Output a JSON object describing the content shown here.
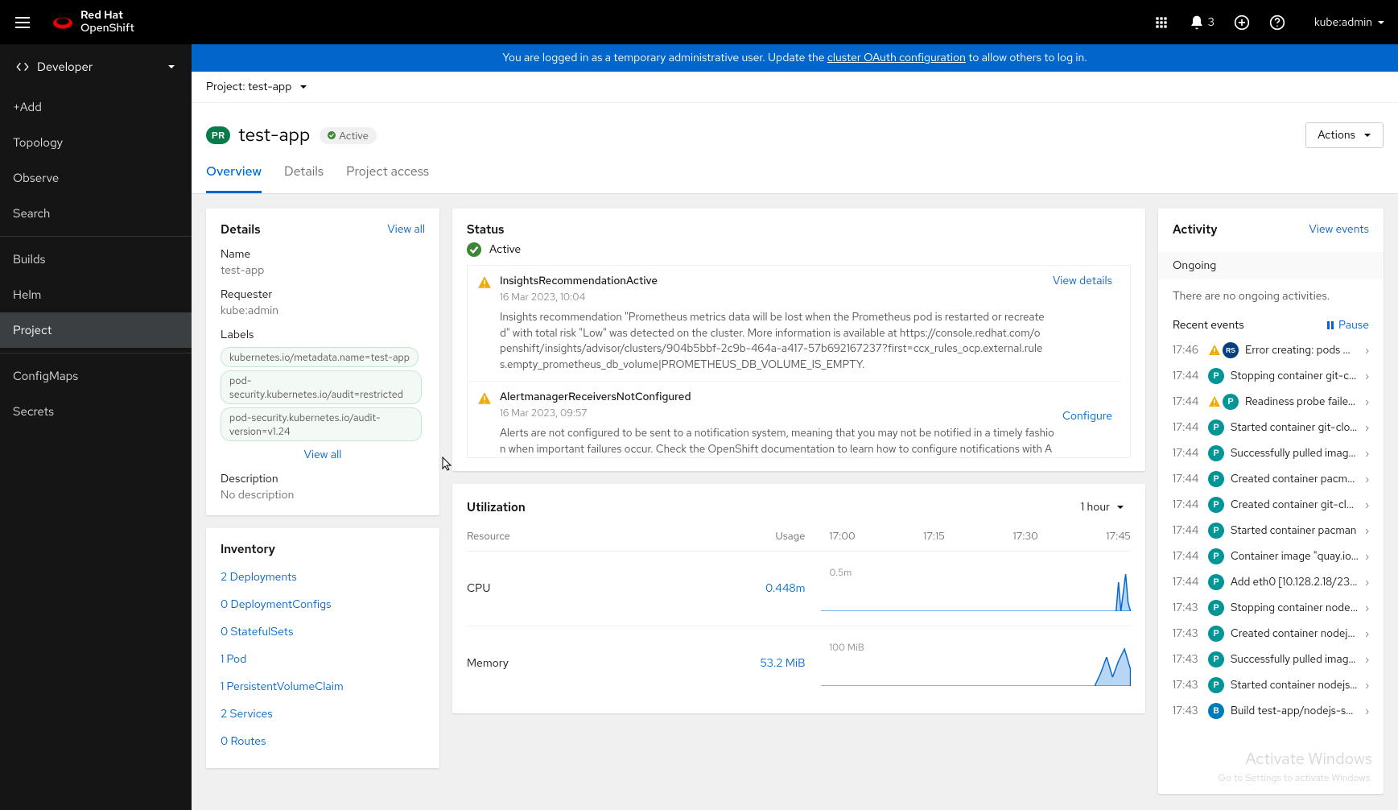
{
  "brand": {
    "rh": "Red Hat",
    "os": "OpenShift"
  },
  "header": {
    "notif_count": "3",
    "username": "kube:admin"
  },
  "sidebar": {
    "perspective": "Developer",
    "items": [
      "+Add",
      "Topology",
      "Observe",
      "Search",
      "Builds",
      "Helm",
      "Project",
      "ConfigMaps",
      "Secrets"
    ]
  },
  "banner": {
    "prefix": "You are logged in as a temporary administrative user. Update the ",
    "link": "cluster OAuth configuration",
    "suffix": " to allow others to log in."
  },
  "project_row": {
    "label": "Project: test-app"
  },
  "title": {
    "badge": "PR",
    "name": "test-app",
    "status": "Active",
    "actions": "Actions"
  },
  "tabs": [
    "Overview",
    "Details",
    "Project access"
  ],
  "details": {
    "heading": "Details",
    "viewall": "View all",
    "name_k": "Name",
    "name_v": "test-app",
    "req_k": "Requester",
    "req_v": "kube:admin",
    "labels_k": "Labels",
    "labels": [
      "kubernetes.io/metadata.name=test-app",
      "pod-security.kubernetes.io/audit=restricted",
      "pod-security.kubernetes.io/audit-version=v1.24"
    ],
    "view_all_labels": "View all",
    "desc_k": "Description",
    "desc_v": "No description"
  },
  "inventory": {
    "heading": "Inventory",
    "items": [
      "2 Deployments",
      "0 DeploymentConfigs",
      "0 StatefulSets",
      "1 Pod",
      "1 PersistentVolumeClaim",
      "2 Services",
      "0 Routes"
    ]
  },
  "status": {
    "heading": "Status",
    "active": "Active",
    "alerts": [
      {
        "title": "InsightsRecommendationActive",
        "time": "16 Mar 2023, 10:04",
        "desc": "Insights recommendation \"Prometheus metrics data will be lost when the Prometheus pod is restarted or recreated\" with total risk \"Low\" was detected on the cluster. More information is available at https://console.redhat.com/openshift/insights/advisor/clusters/904b5bbf-2c9b-464a-a417-57b692167237?first=ccx_rules_ocp.external.rules.empty_prometheus_db_volume|PROMETHEUS_DB_VOLUME_IS_EMPTY.",
        "action": "View details"
      },
      {
        "title": "AlertmanagerReceiversNotConfigured",
        "time": "16 Mar 2023, 09:57",
        "desc": "Alerts are not configured to be sent to a notification system, meaning that you may not be notified in a timely fashion when important failures occur. Check the OpenShift documentation to learn how to configure notifications with Alertmanager.",
        "action": "Configure"
      }
    ]
  },
  "utilization": {
    "heading": "Utilization",
    "range": "1 hour",
    "col_resource": "Resource",
    "col_usage": "Usage",
    "times": [
      "17:00",
      "17:15",
      "17:30",
      "17:45"
    ],
    "rows": [
      {
        "name": "CPU",
        "usage": "0.448m",
        "scale": "0.5m"
      },
      {
        "name": "Memory",
        "usage": "53.2 MiB",
        "scale": "100 MiB"
      }
    ]
  },
  "activity": {
    "heading": "Activity",
    "view_events": "View events",
    "ongoing_h": "Ongoing",
    "no_ongoing": "There are no ongoing activities.",
    "recent_h": "Recent events",
    "pause": "Pause",
    "events": [
      {
        "time": "17:46",
        "warn": true,
        "badge": "RS",
        "badge_cls": "badge-rs",
        "text": "Error creating: pods …"
      },
      {
        "time": "17:44",
        "warn": false,
        "badge": "P",
        "badge_cls": "badge-p",
        "text": "Stopping container git-cl…"
      },
      {
        "time": "17:44",
        "warn": true,
        "badge": "P",
        "badge_cls": "badge-p",
        "text": "Readiness probe faile…"
      },
      {
        "time": "17:44",
        "warn": false,
        "badge": "P",
        "badge_cls": "badge-p",
        "text": "Started container git-clo…"
      },
      {
        "time": "17:44",
        "warn": false,
        "badge": "P",
        "badge_cls": "badge-p",
        "text": "Successfully pulled imag…"
      },
      {
        "time": "17:44",
        "warn": false,
        "badge": "P",
        "badge_cls": "badge-p",
        "text": "Created container pacman"
      },
      {
        "time": "17:44",
        "warn": false,
        "badge": "P",
        "badge_cls": "badge-p",
        "text": "Created container git-clo…"
      },
      {
        "time": "17:44",
        "warn": false,
        "badge": "P",
        "badge_cls": "badge-p",
        "text": "Started container pacman"
      },
      {
        "time": "17:44",
        "warn": false,
        "badge": "P",
        "badge_cls": "badge-p",
        "text": "Container image \"quay.io…"
      },
      {
        "time": "17:44",
        "warn": false,
        "badge": "P",
        "badge_cls": "badge-p",
        "text": "Add eth0 [10.128.2.18/23]…"
      },
      {
        "time": "17:43",
        "warn": false,
        "badge": "P",
        "badge_cls": "badge-p",
        "text": "Stopping container nodej…"
      },
      {
        "time": "17:43",
        "warn": false,
        "badge": "P",
        "badge_cls": "badge-p",
        "text": "Created container nodejs…"
      },
      {
        "time": "17:43",
        "warn": false,
        "badge": "P",
        "badge_cls": "badge-p",
        "text": "Successfully pulled imag…"
      },
      {
        "time": "17:43",
        "warn": false,
        "badge": "P",
        "badge_cls": "badge-p",
        "text": "Started container nodejs…"
      },
      {
        "time": "17:43",
        "warn": false,
        "badge": "B",
        "badge_cls": "badge-b",
        "text": "Build test-app/nodejs-sa…"
      }
    ]
  },
  "watermark": {
    "l1": "Activate Windows",
    "l2": "Go to Settings to activate Windows."
  }
}
